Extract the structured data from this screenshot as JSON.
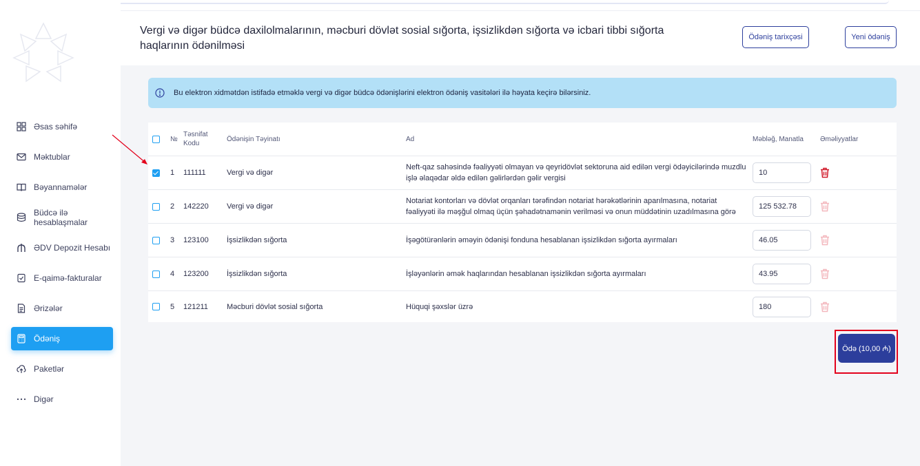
{
  "colors": {
    "accent": "#1e9ff2",
    "primary": "#2c3e9c",
    "info_bg": "#b3e0f7",
    "danger": "#d11a2a",
    "highlight": "#e3001b"
  },
  "sidebar": {
    "items": [
      {
        "label": "Əsas səhifə",
        "icon": "grid-icon"
      },
      {
        "label": "Məktublar",
        "icon": "mail-icon"
      },
      {
        "label": "Bəyannamələr",
        "icon": "book-icon"
      },
      {
        "label": "Büdcə ilə hesablaşmalar",
        "icon": "database-icon"
      },
      {
        "label": "ƏDV Depozit Hesabı",
        "icon": "bank-icon"
      },
      {
        "label": "E-qaimə-fakturalar",
        "icon": "invoice-icon"
      },
      {
        "label": "Ərizələr",
        "icon": "document-icon"
      },
      {
        "label": "Ödəniş",
        "icon": "calculator-icon",
        "active": true
      },
      {
        "label": "Paketlər",
        "icon": "upload-cloud-icon"
      },
      {
        "label": "Digər",
        "icon": "more-icon"
      }
    ]
  },
  "header": {
    "title": "Vergi və digər büdcə daxilolmalarının, məcburi dövlət sosial sığorta, işsizlikdən sığorta və icbari tibbi sığorta haqlarının ödənilməsi",
    "history_button": "Ödəniş tarixçəsi",
    "new_button": "Yeni ödəniş"
  },
  "info": {
    "icon": "info-circle-icon",
    "text": "Bu elektron xidmətdən istifadə etməklə vergi və digər büdcə ödənişlərini elektron ödəniş vasitələri ilə həyata keçirə bilərsiniz."
  },
  "table": {
    "headers": {
      "no": "№",
      "code": "Təsnifat Kodu",
      "purpose": "Ödənişin Təyinatı",
      "name": "Ad",
      "amount": "Məbləğ, Manatla",
      "actions": "Əməliyyatlar"
    },
    "rows": [
      {
        "no": "1",
        "code": "111111",
        "purpose": "Vergi və digər",
        "name": "Neft-qaz sahəsində fəaliyyəti olmayan və qeyridövlət sektoruna aid edilən vergi ödəyicilərində muzdlu işlə əlaqədar əldə edilən gəlirlərdən gəlir vergisi",
        "amount": "10",
        "checked": true
      },
      {
        "no": "2",
        "code": "142220",
        "purpose": "Vergi və digər",
        "name": "Notariat kontorları və dövlət orqanları tərəfindən notariat hərəkətlərinin aparılmasına, notariat fəaliyyəti ilə məşğul olmaq üçün şəhadətnamənin verilməsi və onun müddətinin uzadılmasına görə",
        "amount": "125 532.78",
        "checked": false
      },
      {
        "no": "3",
        "code": "123100",
        "purpose": "İşsizlikdən sığorta",
        "name": "İşəgötürənlərin əməyin ödənişi fonduna hesablanan işsizlikdən sığorta ayırmaları",
        "amount": "46.05",
        "checked": false
      },
      {
        "no": "4",
        "code": "123200",
        "purpose": "İşsizlikdən sığorta",
        "name": "İşləyənlərin əmək haqlarından hesablanan işsizlikdən sığorta ayırmaları",
        "amount": "43.95",
        "checked": false
      },
      {
        "no": "5",
        "code": "121211",
        "purpose": "Məcburi dövlət sosial sığorta",
        "name": "Hüquqi şəxslər üzrə",
        "amount": "180",
        "checked": false
      }
    ]
  },
  "pay_button": "Ödə (10,00 ₼)"
}
